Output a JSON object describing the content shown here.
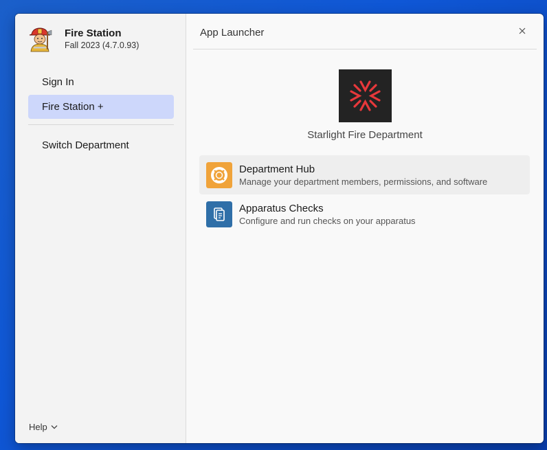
{
  "app": {
    "title": "Fire Station",
    "version": "Fall 2023 (4.7.0.93)",
    "icon": "firefighter-avatar-icon"
  },
  "sidebar": {
    "items": [
      {
        "label": "Sign In",
        "active": false
      },
      {
        "label": "Fire Station +",
        "active": true
      },
      {
        "label": "Switch Department",
        "active": false
      }
    ],
    "help_label": "Help",
    "help_icon": "chevron-down-icon"
  },
  "launcher": {
    "title": "App Launcher",
    "close_icon": "close-icon",
    "department_name": "Starlight Fire Department",
    "department_logo": "starburst-logo",
    "apps": [
      {
        "title": "Department Hub",
        "description": "Manage your department members, permissions, and software",
        "icon": "lifebuoy-icon",
        "icon_color": "#f0a33a"
      },
      {
        "title": "Apparatus Checks",
        "description": "Configure and run checks on your apparatus",
        "icon": "documents-icon",
        "icon_color": "#2f6fa8"
      }
    ]
  },
  "colors": {
    "active_nav": "#cdd7fb",
    "desktop": "#0f57d6",
    "logo_accent": "#e8383b"
  }
}
